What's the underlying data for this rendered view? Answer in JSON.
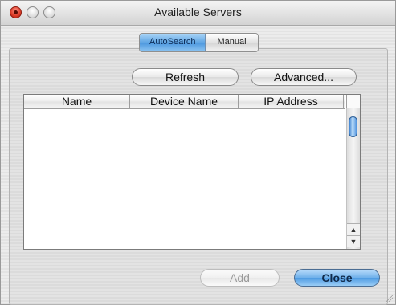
{
  "window": {
    "title": "Available Servers"
  },
  "tabs": {
    "selected": "AutoSearch",
    "other": "Manual"
  },
  "buttons": {
    "refresh": "Refresh",
    "advanced": "Advanced...",
    "add": "Add",
    "close": "Close"
  },
  "table": {
    "columns": [
      "Name",
      "Device Name",
      "IP Address"
    ],
    "rows": []
  },
  "colors": {
    "accent": "#4b97de",
    "close_light": "#e0402c"
  },
  "scrollbar": {
    "up_arrow": "▲",
    "down_arrow": "▼"
  }
}
